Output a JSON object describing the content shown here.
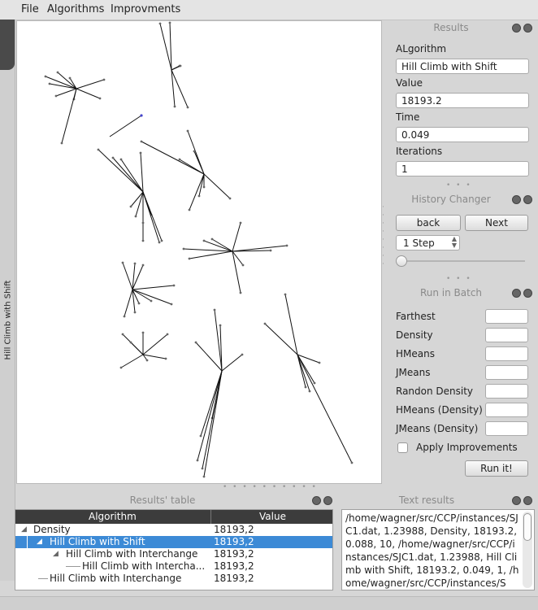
{
  "menu": [
    "File",
    "Algorithms",
    "Improvments"
  ],
  "side_tab_label": "Hill Climb with Shift",
  "results": {
    "title": "Results",
    "algorithm_label": "ALgorithm",
    "algorithm_value": "Hill Climb with Shift",
    "value_label": "Value",
    "value_value": "18193.2",
    "time_label": "Time",
    "time_value": "0.049",
    "iterations_label": "Iterations",
    "iterations_value": "1"
  },
  "history": {
    "title": "History Changer",
    "back": "back",
    "next": "Next",
    "step_value": "1 Step",
    "slider_level": 0
  },
  "batch": {
    "title": "Run in Batch",
    "items": [
      "Farthest",
      "Density",
      "HMeans",
      "JMeans",
      "Randon Density",
      "HMeans (Density)",
      "JMeans (Density)"
    ],
    "apply_label": "Apply Improvements",
    "run_label": "Run it!"
  },
  "results_table": {
    "title": "Results' table",
    "col_algorithm": "Algorithm",
    "col_value": "Value",
    "rows": [
      {
        "name": "Density",
        "value": "18193,2"
      },
      {
        "name": "Hill Climb with Shift",
        "value": "18193,2"
      },
      {
        "name": "Hill Climb with Interchange",
        "value": "18193,2"
      },
      {
        "name": "Hill Climb with Intercha...",
        "value": "18193,2"
      },
      {
        "name": "Hill Climb with Interchange",
        "value": "18193,2"
      }
    ]
  },
  "text_results": {
    "title": "Text results",
    "content": "/home/wagner/src/CCP/instances/SJC1.dat, 1.23988, Density, 18193.2, 0.088, 10, /home/wagner/src/CCP/instances/SJC1.dat, 1.23988, Hill Climb with Shift, 18193.2, 0.049, 1, /home/wagner/src/CCP/instances/S"
  }
}
